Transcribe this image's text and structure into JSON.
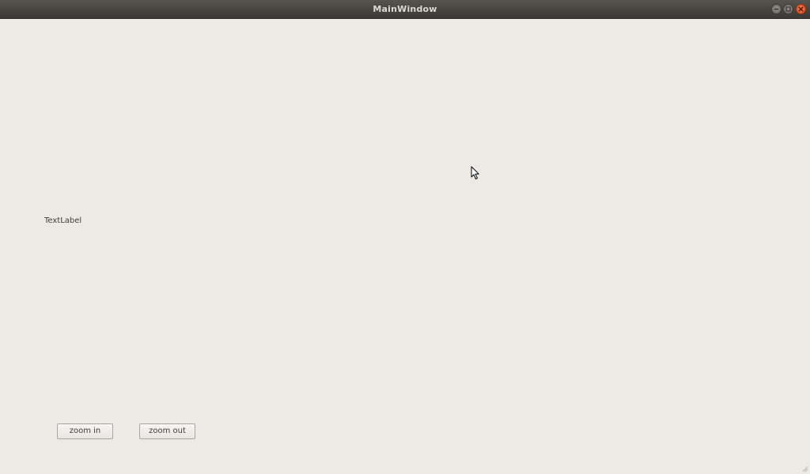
{
  "window": {
    "title": "MainWindow",
    "controls": {
      "minimize": "minimize-icon",
      "maximize": "maximize-icon",
      "close": "close-icon"
    },
    "colors": {
      "background": "#edeae5",
      "titlebar": "#46433f",
      "close_button": "#e95420"
    }
  },
  "main": {
    "label": "TextLabel",
    "buttons": {
      "zoom_in": "zoom in",
      "zoom_out": "zoom out"
    }
  }
}
